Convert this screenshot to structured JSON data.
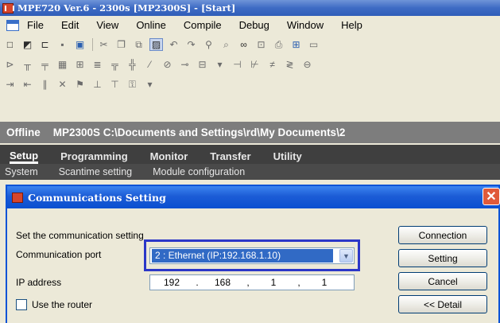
{
  "window": {
    "title": "MPE720 Ver.6 - 2300s [MP2300S] - [Start]"
  },
  "menu": {
    "items": [
      "File",
      "Edit",
      "View",
      "Online",
      "Compile",
      "Debug",
      "Window",
      "Help"
    ]
  },
  "toolbar": {
    "row1": [
      "new-icon",
      "open-icon",
      "open-folder-icon",
      "save-icon",
      "save-all-icon",
      "cut-icon",
      "copy-icon",
      "paste-icon",
      "image-icon",
      "undo-icon",
      "redo-icon",
      "find-icon",
      "find-replace-icon",
      "binoculars-icon",
      "zoom-icon",
      "print-icon",
      "print-preview-icon",
      "window-icon"
    ],
    "row2": [
      "ladder-contact-icon",
      "ladder-nc-icon",
      "ladder-coil-icon",
      "ladder-box-icon",
      "ladder-func-icon",
      "ladder-compare-icon",
      "ladder-branch-icon",
      "ladder-mid-icon",
      "ladder-line-icon",
      "ladder-vline-icon",
      "ladder-link-icon",
      "ladder-block-icon",
      "ladder-dropdown-icon",
      "rung-a-icon",
      "rung-b-icon",
      "rung-c-icon",
      "rung-d-icon",
      "rung-e-icon"
    ],
    "row3": [
      "indent-icon",
      "outdent-icon",
      "comment-icon",
      "delete-comment-icon",
      "bookmark-icon",
      "step-icon",
      "chart-icon",
      "help-ext-icon",
      "dropdown-icon"
    ]
  },
  "status": {
    "state": "Offline",
    "path": "MP2300S  C:\\Documents and Settings\\rd\\My Documents\\2"
  },
  "nav": {
    "tabs": [
      "Setup",
      "Programming",
      "Monitor",
      "Transfer",
      "Utility"
    ],
    "active": "Setup",
    "subitems": [
      "System",
      "Scantime setting",
      "Module configuration"
    ]
  },
  "dialog": {
    "title": "Communications Setting",
    "set_label": "Set the communication setting",
    "port_label": "Communication port",
    "port_value": "2 : Ethernet (IP:192.168.1.10)",
    "ip_label": "IP address",
    "ip": [
      "192",
      "168",
      "1",
      "1"
    ],
    "router_label": "Use the router",
    "router_checked": false,
    "buttons": {
      "connection": "Connection",
      "setting": "Setting",
      "cancel": "Cancel",
      "detail": "<< Detail"
    }
  }
}
